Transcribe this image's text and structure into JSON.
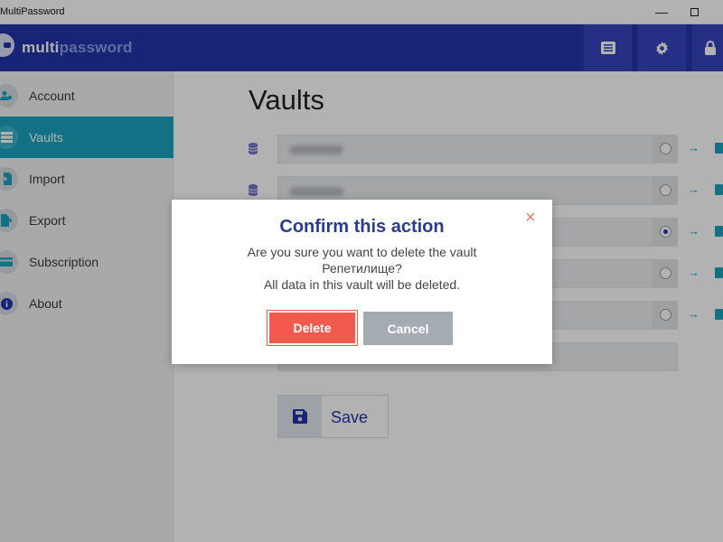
{
  "window": {
    "title": "MultiPassword",
    "controls": {
      "minimize": "—"
    }
  },
  "header": {
    "brand_part1": "multi",
    "brand_part2": "password",
    "buttons": [
      "list-icon",
      "gear-icon",
      "lock-icon"
    ]
  },
  "sidebar": {
    "items": [
      {
        "label": "Account",
        "icon": "account-icon",
        "active": false
      },
      {
        "label": "Vaults",
        "icon": "vaults-icon",
        "active": true
      },
      {
        "label": "Import",
        "icon": "import-icon",
        "active": false
      },
      {
        "label": "Export",
        "icon": "export-icon",
        "active": false
      },
      {
        "label": "Subscription",
        "icon": "card-icon",
        "active": false
      },
      {
        "label": "About",
        "icon": "info-icon",
        "active": false
      }
    ]
  },
  "main": {
    "title": "Vaults",
    "vaults": [
      {
        "selected": false,
        "go_icon": "→"
      },
      {
        "selected": false,
        "go_icon": "→"
      },
      {
        "selected": true,
        "go_icon": "→"
      },
      {
        "selected": false,
        "go_icon": "→"
      },
      {
        "selected": false,
        "go_icon": "→"
      }
    ],
    "save_label": "Save"
  },
  "dialog": {
    "title": "Confirm this action",
    "close": "×",
    "line1": "Are you sure you want to delete the vault",
    "line2": "Репетилище?",
    "line3": "All data in this vault will be deleted.",
    "delete_label": "Delete",
    "cancel_label": "Cancel"
  },
  "colors": {
    "header": "#2335ab",
    "active_nav": "#1aa3bd",
    "delete": "#f25a4d",
    "cancel": "#a3acb3",
    "dialog_title": "#2a3c92"
  }
}
